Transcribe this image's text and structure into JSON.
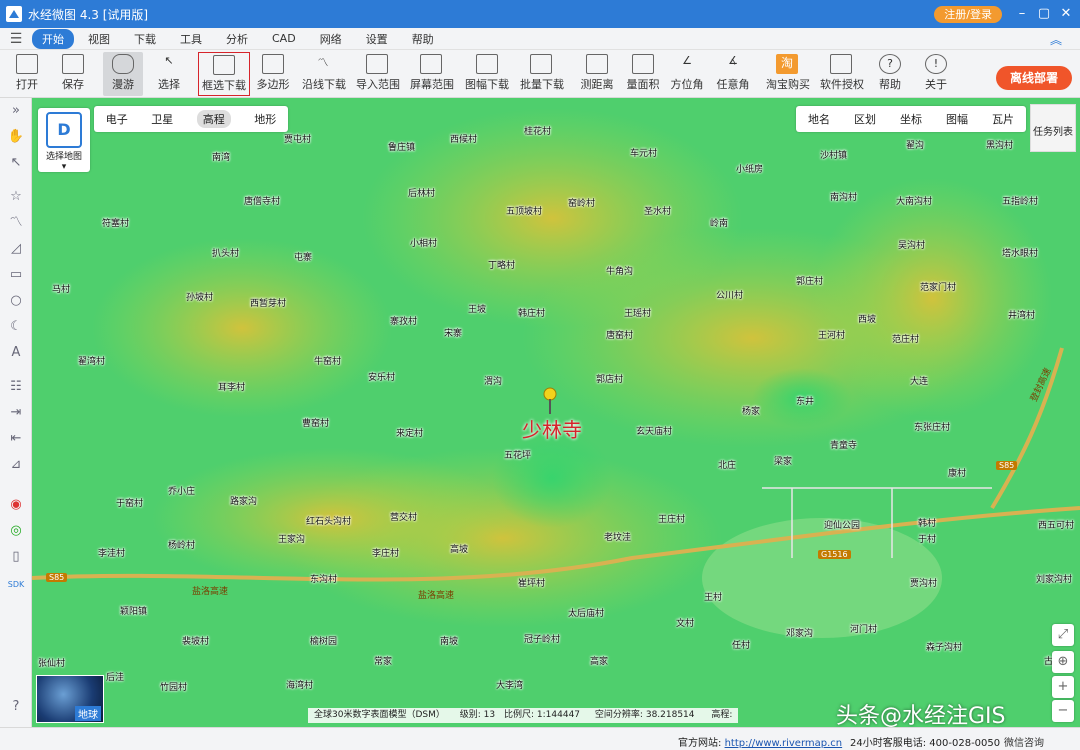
{
  "window": {
    "title": "水经微图 4.3 [试用版]",
    "register_label": "注册/登录"
  },
  "menu": {
    "items": [
      "开始",
      "视图",
      "下载",
      "工具",
      "分析",
      "CAD",
      "网络",
      "设置",
      "帮助"
    ]
  },
  "toolbar": {
    "items": [
      {
        "label": "打开",
        "icon": "folder-icon"
      },
      {
        "label": "保存",
        "icon": "save-icon"
      },
      {
        "label": "漫游",
        "icon": "hand-icon"
      },
      {
        "label": "选择",
        "icon": "cursor-icon"
      },
      {
        "label": "框选下载",
        "icon": "box-download-icon"
      },
      {
        "label": "多边形",
        "icon": "polygon-icon"
      },
      {
        "label": "沿线下载",
        "icon": "line-download-icon"
      },
      {
        "label": "导入范围",
        "icon": "import-icon"
      },
      {
        "label": "屏幕范围",
        "icon": "screen-icon"
      },
      {
        "label": "图幅下载",
        "icon": "grid-icon"
      },
      {
        "label": "批量下载",
        "icon": "batch-icon"
      },
      {
        "label": "测距离",
        "icon": "ruler-icon"
      },
      {
        "label": "量面积",
        "icon": "area-icon"
      },
      {
        "label": "方位角",
        "icon": "azimuth-icon"
      },
      {
        "label": "任意角",
        "icon": "angle-icon"
      },
      {
        "label": "淘宝购买",
        "icon": "taobao-icon"
      },
      {
        "label": "软件授权",
        "icon": "lock-icon"
      },
      {
        "label": "帮助",
        "icon": "question-icon"
      },
      {
        "label": "关于",
        "icon": "info-icon"
      }
    ],
    "offline_label": "离线部署"
  },
  "map": {
    "types": [
      "电子",
      "卫星",
      "高程",
      "地形"
    ],
    "select_map_label": "选择地图",
    "layers": [
      "地名",
      "区划",
      "坐标",
      "图幅",
      "瓦片"
    ],
    "task_list_label": "任务列表",
    "highlight_label": "少林寺",
    "earth_label": "地球",
    "places": [
      "贾屯村",
      "西候村",
      "桂花村",
      "鲁庄镇",
      "车元村",
      "小纸房",
      "沙村镇",
      "翟沟",
      "黑沟村",
      "南湾",
      "唐僧寺村",
      "后林村",
      "南沟村",
      "大南沟村",
      "五指岭村",
      "符塞村",
      "五顶坡村",
      "窑岭村",
      "圣水村",
      "岭南",
      "小相村",
      "吴沟村",
      "塔水眼村",
      "扒头村",
      "屯寨",
      "丁略村",
      "牛角沟",
      "郭庄村",
      "范家门村",
      "马村",
      "孙坡村",
      "西暂芽村",
      "王坡",
      "韩庄村",
      "王瑶村",
      "公川村",
      "井湾村",
      "寨孜村",
      "宋寨",
      "唐窑村",
      "王河村",
      "西坡",
      "范庄村",
      "翟湾村",
      "牛窑村",
      "安乐村",
      "渭沟",
      "郭店村",
      "大连",
      "耳李村",
      "杨家",
      "东井",
      "曹窑村",
      "来定村",
      "玄天庙村",
      "青童寺",
      "东张庄村",
      "五花坪",
      "北庄",
      "梁家",
      "康村",
      "乔小庄",
      "于窑村",
      "路家沟",
      "红石头沟村",
      "营交村",
      "王庄村",
      "韩村",
      "西五可村",
      "杨岭村",
      "王家沟",
      "李庄村",
      "高坡",
      "老坟洼",
      "于村",
      "李洼村",
      "东沟村",
      "崔坪村",
      "贾沟村",
      "刘家沟村",
      "颖阳镇",
      "太后庙村",
      "王村",
      "文村",
      "裴坡村",
      "榆树园",
      "南坡",
      "冠子岭村",
      "任村",
      "邓家沟",
      "河门村",
      "张仙村",
      "后洼",
      "常家",
      "高家",
      "森子沟村",
      "竹园村",
      "海湾村",
      "大李湾",
      "古城镇",
      "迎仙公园"
    ],
    "highways": [
      {
        "name": "登封高速"
      },
      {
        "name": "盐洛高速"
      },
      {
        "name": "盐洛高速"
      }
    ],
    "shields": [
      "S85",
      "S85",
      "G1516"
    ],
    "status": {
      "dataset": "全球30米数字表面模型（DSM）",
      "level_label": "级别:",
      "level": "13",
      "scale_label": "比例尺:",
      "scale": "1:144447",
      "coord_label": "空间分辨率:",
      "coord": "38.218514",
      "elev_label": "高程:"
    }
  },
  "footer": {
    "site_label": "官方网站:",
    "site_url": "http://www.rivermap.cn",
    "phone_label": "24小时客服电话:",
    "phone": "400-028-0050",
    "wechat": "微信咨询"
  },
  "watermark": "头条@水经注GIS",
  "colors": {
    "titlebar": "#2d7bd6",
    "offline": "#f0552a",
    "highlight": "#d6242b",
    "register": "#f39a2f"
  }
}
